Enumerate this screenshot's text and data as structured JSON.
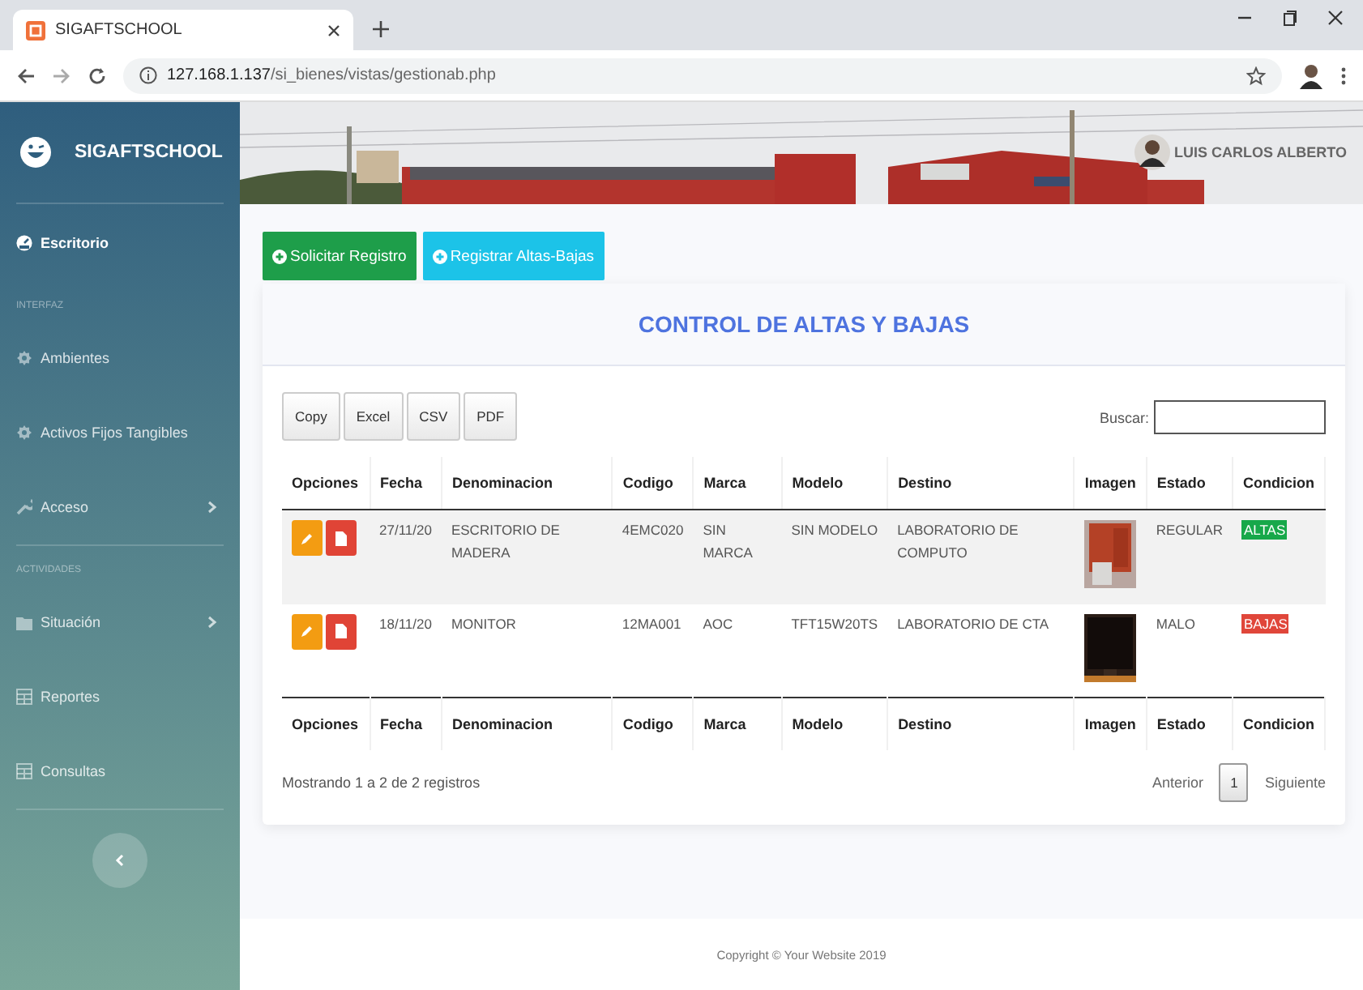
{
  "browser": {
    "tab_title": "SIGAFTSCHOOL",
    "url_host": "127.168.1.137",
    "url_path": "/si_bienes/vistas/gestionab.php"
  },
  "sidebar": {
    "brand": "SIGAFTSCHOOL",
    "items": [
      {
        "kind": "dashboard",
        "label": "Escritorio",
        "submenu": false
      },
      {
        "kind": "heading",
        "label": "INTERFAZ"
      },
      {
        "kind": "gear",
        "label": "Ambientes",
        "submenu": false
      },
      {
        "kind": "gear",
        "label": "Activos Fijos Tangibles",
        "submenu": false
      },
      {
        "kind": "wrench",
        "label": "Acceso",
        "submenu": true
      },
      {
        "kind": "heading",
        "label": "ACTIVIDADES"
      },
      {
        "kind": "folder",
        "label": "Situación",
        "submenu": true
      },
      {
        "kind": "table",
        "label": "Reportes",
        "submenu": false
      },
      {
        "kind": "table",
        "label": "Consultas",
        "submenu": false
      }
    ]
  },
  "header": {
    "user": "LUIS CARLOS ALBERTO"
  },
  "actions": [
    {
      "label": "Solicitar Registro",
      "color": "#1e9e4a"
    },
    {
      "label": "Registrar Altas-Bajas",
      "color": "#1cc3e8"
    }
  ],
  "card": {
    "title": "CONTROL DE ALTAS Y BAJAS",
    "export_buttons": [
      "Copy",
      "Excel",
      "CSV",
      "PDF"
    ],
    "search_label": "Buscar:",
    "columns": [
      "Opciones",
      "Fecha",
      "Denominacion",
      "Codigo",
      "Marca",
      "Modelo",
      "Destino",
      "Imagen",
      "Estado",
      "Condicion"
    ],
    "rows": [
      {
        "fecha": "27/11/20",
        "denominacion": "ESCRITORIO DE MADERA",
        "codigo": "4EMC020",
        "marca": "SIN MARCA",
        "modelo": "SIN MODELO",
        "destino": "LABORATORIO DE COMPUTO",
        "estado": "REGULAR",
        "condicion": {
          "text": "ALTAS",
          "color": "#17a84a"
        }
      },
      {
        "fecha": "18/11/20",
        "denominacion": "MONITOR",
        "codigo": "12MA001",
        "marca": "AOC",
        "modelo": "TFT15W20TS",
        "destino": "LABORATORIO DE CTA",
        "estado": "MALO",
        "condicion": {
          "text": "BAJAS",
          "color": "#e0463a"
        }
      }
    ],
    "footer_columns": [
      "Opciones",
      "Fecha",
      "Denominacion",
      "Codigo",
      "Marca",
      "Modelo",
      "Destino",
      "Imagen",
      "Estado",
      "Condicion"
    ],
    "info": "Mostrando 1 a 2 de 2 registros",
    "pagination": {
      "previous": "Anterior",
      "pages": [
        {
          "label": "1",
          "selected": true
        }
      ],
      "next": "Siguiente"
    }
  },
  "footer": "Copyright © Your Website 2019"
}
